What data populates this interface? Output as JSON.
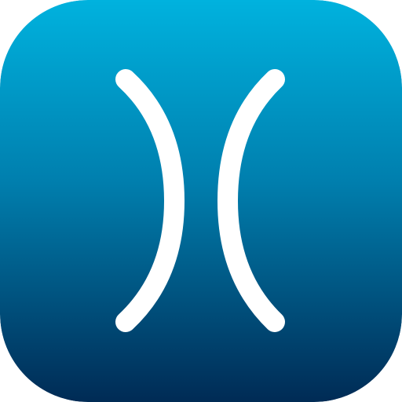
{
  "icon": {
    "name": "app-icon",
    "glyph": "paired-curves-icon",
    "colors": {
      "gradient_top": "#00B2DE",
      "gradient_mid": "#007FAE",
      "gradient_bottom": "#002B55",
      "glyph": "#FFFFFF"
    }
  }
}
